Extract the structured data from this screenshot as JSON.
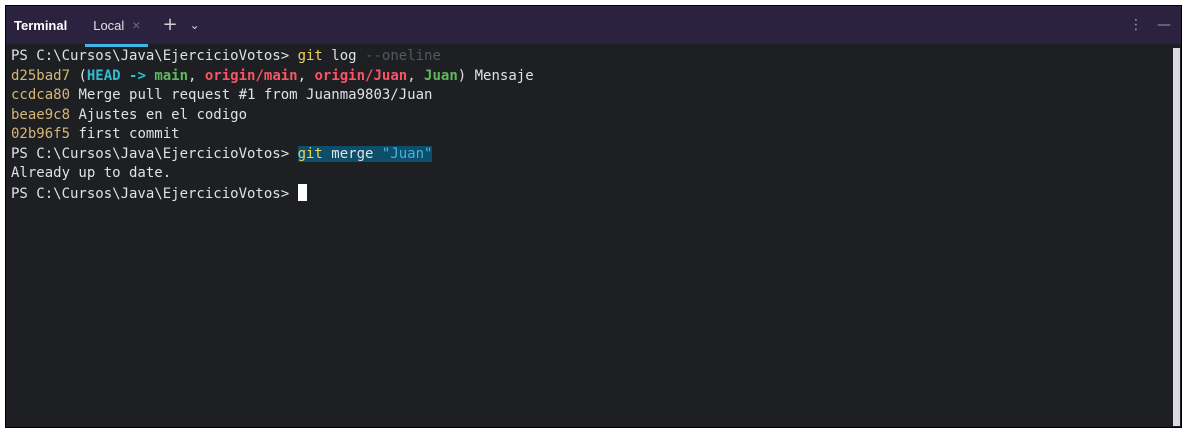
{
  "tabbar": {
    "title": "Terminal",
    "tab_label": "Local",
    "close_glyph": "×",
    "add_glyph": "+",
    "chevron_glyph": "⌄",
    "menu_glyph": "⋮",
    "minimize_glyph": "—",
    "icons": [
      "close-icon",
      "plus-icon",
      "chevron-down-icon",
      "more-vert-icon",
      "minimize-icon"
    ]
  },
  "terminal": {
    "prompt": "PS C:\\Cursos\\Java\\EjercicioVotos> ",
    "line1": {
      "cmd": "git",
      "arg": " log ",
      "flag": "--oneline"
    },
    "commit1": {
      "hash": "d25bad7",
      "open": " (",
      "head": "HEAD -> ",
      "main": "main",
      "sep1": ", ",
      "origin_main": "origin/main",
      "sep2": ", ",
      "origin_juan": "origin/Juan",
      "sep3": ", ",
      "juan": "Juan",
      "close": ")",
      "msg": " Mensaje"
    },
    "commit2": {
      "hash": "ccdca80",
      "msg": " Merge pull request #1 from Juanma9803/Juan"
    },
    "commit3": {
      "hash": "beae9c8",
      "msg": " Ajustes en el codigo"
    },
    "commit4": {
      "hash": "02b96f5",
      "msg": " first commit"
    },
    "line6": {
      "cmd": "git",
      "arg": " merge ",
      "str": "\"Juan\""
    },
    "output": "Already up to date."
  },
  "colors": {
    "background": "#1e1f22",
    "tabbar": "#2b2240",
    "accent": "#3fb6e6",
    "hash": "#d5b778",
    "head": "#2fbccd",
    "branch": "#5fb85f",
    "remote": "#f75464",
    "command": "#f0d655"
  }
}
